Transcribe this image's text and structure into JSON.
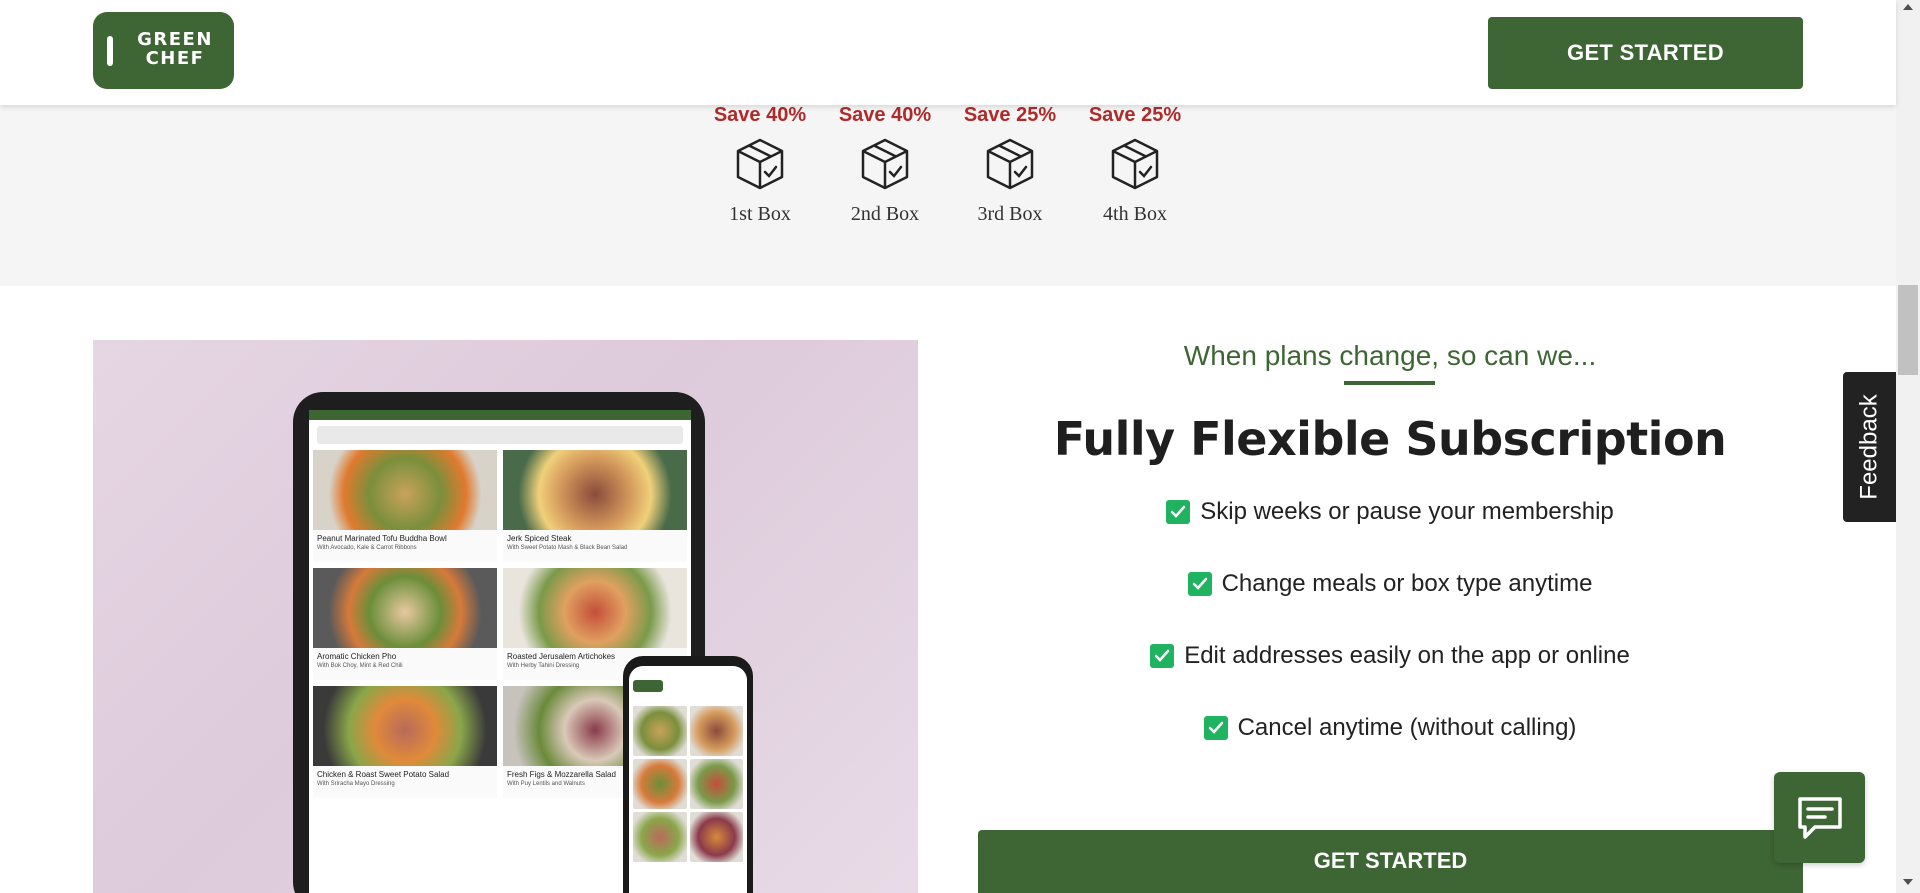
{
  "header": {
    "logo_line1": "GREEN",
    "logo_line2": "CHEF",
    "cta_label": "GET STARTED"
  },
  "savings": {
    "items": [
      {
        "save": "Save 40%",
        "label": "1st Box"
      },
      {
        "save": "Save 40%",
        "label": "2nd Box"
      },
      {
        "save": "Save 25%",
        "label": "3rd Box"
      },
      {
        "save": "Save 25%",
        "label": "4th Box"
      }
    ]
  },
  "subscription": {
    "eyebrow": "When plans change, so can we...",
    "title": "Fully Flexible Subscription",
    "features": [
      "Skip weeks or pause your membership",
      "Change meals or box type anytime",
      "Edit addresses easily on the app or online",
      "Cancel anytime (without calling)"
    ],
    "cta_label": "GET STARTED"
  },
  "tablet_menu": {
    "items": [
      {
        "title": "Peanut Marinated Tofu Buddha Bowl",
        "subtitle": "With Avocado, Kale & Carrot Ribbons"
      },
      {
        "title": "Jerk Spiced Steak",
        "subtitle": "With Sweet Potato Mash & Black Bean Salad"
      },
      {
        "title": "Aromatic Chicken Pho",
        "subtitle": "With Bok Choy, Mint & Red Chili"
      },
      {
        "title": "Roasted Jerusalem Artichokes",
        "subtitle": "With Herby Tahini Dressing"
      },
      {
        "title": "Chicken & Roast Sweet Potato Salad",
        "subtitle": "With Sriracha Mayo Dressing"
      },
      {
        "title": "Fresh Figs & Mozzarella Salad",
        "subtitle": "With Puy Lentils and Walnuts"
      }
    ]
  },
  "feedback": {
    "label": "Feedback"
  },
  "colors": {
    "brand_green": "#3e6534",
    "save_red": "#b02a2a",
    "check_green": "#1fb35f",
    "band_gray": "#f5f5f5"
  },
  "icons": [
    "box-check-icon",
    "checkbox-icon",
    "chat-icon"
  ]
}
